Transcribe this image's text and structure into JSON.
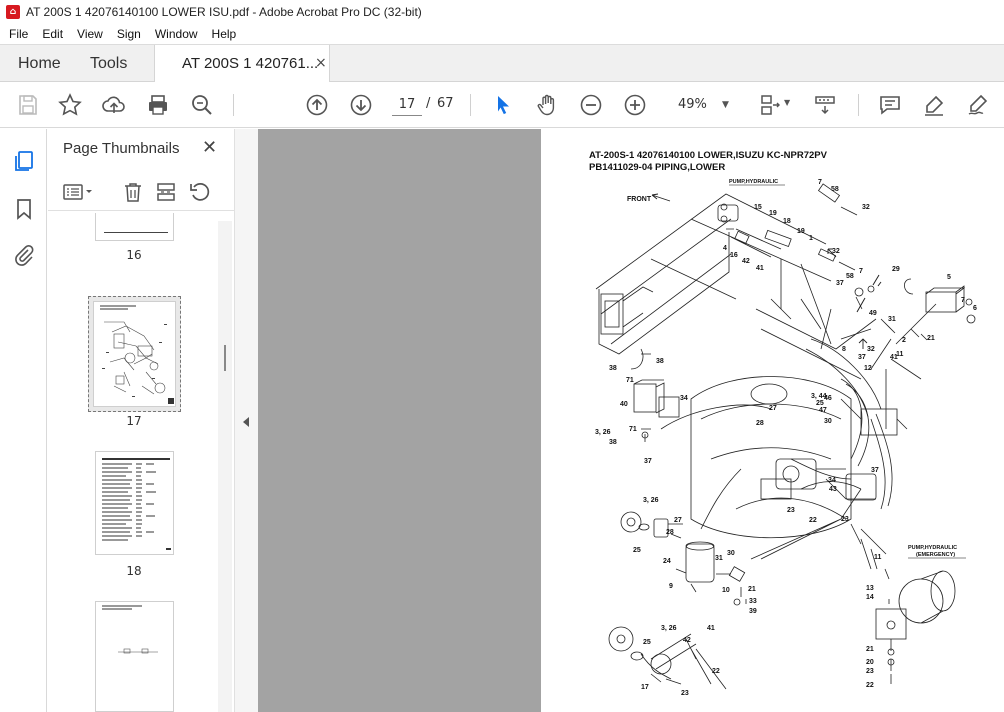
{
  "window": {
    "title": "AT 200S 1 42076140100 LOWER ISU.pdf - Adobe Acrobat Pro DC (32-bit)",
    "app_icon": "acrobat-icon"
  },
  "menu": [
    "File",
    "Edit",
    "View",
    "Sign",
    "Window",
    "Help"
  ],
  "tabs": {
    "home": "Home",
    "tools": "Tools",
    "document": "AT 200S 1 420761...",
    "close": "×"
  },
  "toolbar": {
    "icons": [
      "save-icon",
      "bookmark-star-icon",
      "upload-icon",
      "print-icon",
      "search-zoom-icon",
      "page-up-icon",
      "page-down-icon",
      "select-cursor-icon",
      "hand-icon",
      "zoom-out-icon",
      "zoom-in-icon",
      "fit-page-icon",
      "scrolling-mode-icon",
      "comment-icon",
      "highlight-pen-icon",
      "sign-icon"
    ],
    "page_current": "17",
    "page_separator": "/",
    "page_total": "67",
    "zoom": "49%",
    "accent": "#1473e6"
  },
  "sidebar": {
    "title": "Page Thumbnails",
    "close": "✕",
    "thumbnails": [
      {
        "label": "16"
      },
      {
        "label": "17",
        "selected": true
      },
      {
        "label": "18"
      },
      {
        "label": ""
      }
    ]
  },
  "document": {
    "title_line1": "AT-200S-1 42076140100 LOWER,ISUZU KC-NPR72PV",
    "title_line2": "PB1411029-04 PIPING,LOWER",
    "labels": {
      "front": "FRONT",
      "pump_hydraulic": "PUMP,HYDRAULIC",
      "pump_hydraulic_emergency_1": "PUMP,HYDRAULIC",
      "pump_hydraulic_emergency_2": "(EMERGENCY)"
    },
    "part_numbers": [
      "7",
      "58",
      "32",
      "15",
      "19",
      "18",
      "19",
      "1",
      "4",
      "16",
      "42",
      "41",
      "32",
      "5",
      "7",
      "6",
      "29",
      "37",
      "58",
      "7",
      "49",
      "31",
      "2",
      "21",
      "8",
      "32",
      "37",
      "41",
      "11",
      "12",
      "38",
      "71",
      "38",
      "40",
      "34",
      "71",
      "3, 26",
      "38",
      "37",
      "28",
      "27",
      "3, 44",
      "25",
      "46",
      "47",
      "30",
      "4",
      "43",
      "3",
      "23",
      "22",
      "23",
      "37",
      "3, 26",
      "28",
      "27",
      "24",
      "25",
      "30",
      "31",
      "10",
      "21",
      "33",
      "39",
      "9",
      "3, 26",
      "42",
      "41",
      "25",
      "17",
      "23",
      "22",
      "11",
      "13",
      "14",
      "21",
      "20",
      "23",
      "22"
    ]
  }
}
